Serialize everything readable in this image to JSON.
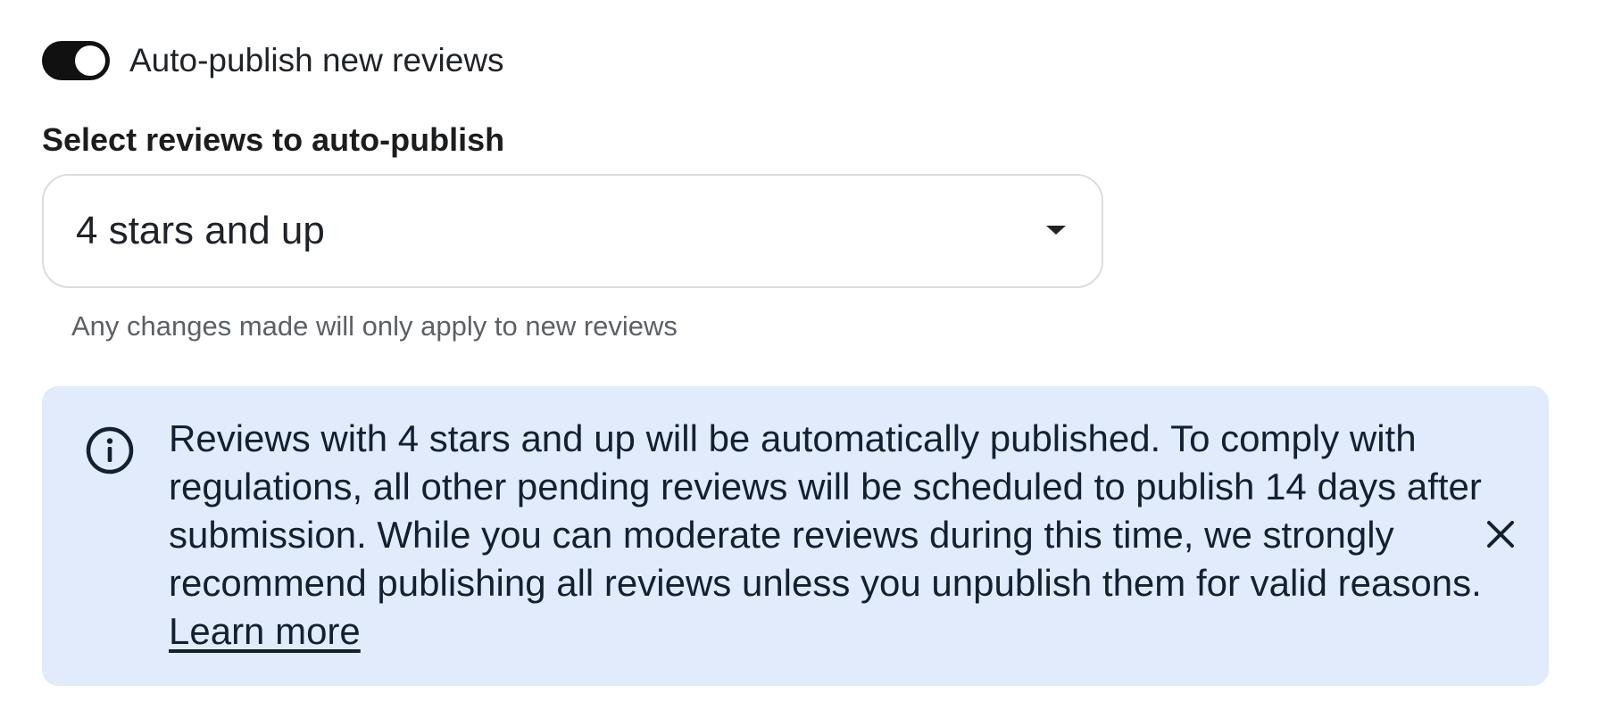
{
  "toggle": {
    "label": "Auto-publish new reviews",
    "state": "on"
  },
  "select": {
    "label": "Select reviews to auto-publish",
    "value": "4 stars and up",
    "help_text": "Any changes made will only apply to new reviews"
  },
  "banner": {
    "icon": "info-icon",
    "text": "Reviews with 4 stars and up will be automatically published. To comply with regulations, all other pending reviews will be scheduled to publish 14 days after submission. While you can moderate reviews during this time, we strongly recommend publishing all reviews unless you unpublish them for valid reasons.",
    "link_label": "Learn more",
    "close_icon": "close-icon"
  },
  "colors": {
    "toggle_on": "#111111",
    "banner_bg": "#e1ebfb",
    "text_primary": "#1f2328",
    "text_secondary": "#5c6166"
  }
}
